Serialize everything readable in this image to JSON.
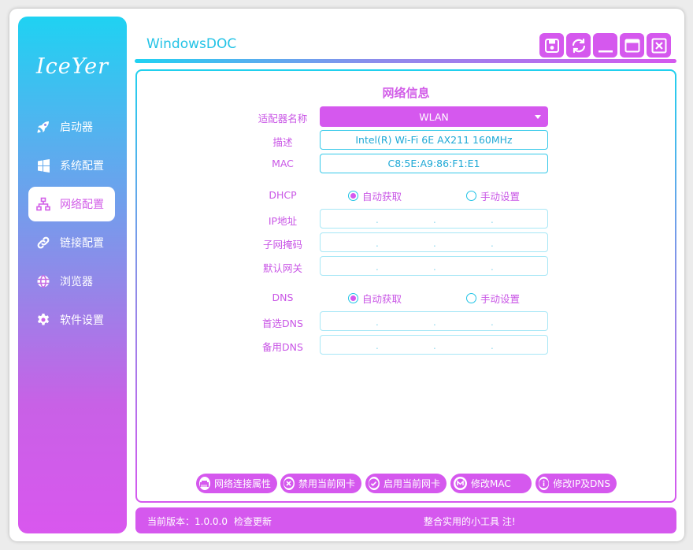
{
  "sidebar": {
    "logo": "IceYer",
    "items": [
      {
        "label": "启动器",
        "icon": "rocket-icon"
      },
      {
        "label": "系统配置",
        "icon": "windows-icon"
      },
      {
        "label": "网络配置",
        "icon": "network-icon"
      },
      {
        "label": "链接配置",
        "icon": "link-icon"
      },
      {
        "label": "浏览器",
        "icon": "globe-icon"
      },
      {
        "label": "软件设置",
        "icon": "gear-icon"
      }
    ],
    "active_index": 2
  },
  "header": {
    "title": "WindowsDOC",
    "buttons": [
      "save-icon",
      "refresh-icon",
      "minimize-icon",
      "maximize-icon",
      "close-icon"
    ]
  },
  "panel": {
    "title": "网络信息",
    "adapter_label": "适配器名称",
    "adapter_value": "WLAN",
    "desc_label": "描述",
    "desc_value": "Intel(R) Wi-Fi 6E AX211 160MHz",
    "mac_label": "MAC",
    "mac_value": "C8:5E:A9:86:F1:E1",
    "dhcp_label": "DHCP",
    "dhcp_auto": "自动获取",
    "dhcp_manual": "手动设置",
    "ip_label": "IP地址",
    "mask_label": "子网掩码",
    "gateway_label": "默认网关",
    "dns_label": "DNS",
    "dns_auto": "自动获取",
    "dns_manual": "手动设置",
    "dns1_label": "首选DNS",
    "dns2_label": "备用DNS"
  },
  "actions": [
    {
      "label": "网络连接属性",
      "icon": "ethernet-icon"
    },
    {
      "label": "禁用当前网卡",
      "icon": "disable-icon"
    },
    {
      "label": "启用当前网卡",
      "icon": "check-icon"
    },
    {
      "label": "修改MAC",
      "icon": "mac-icon"
    },
    {
      "label": "修改IP及DNS",
      "icon": "info-icon"
    }
  ],
  "status": {
    "version": "当前版本：1.0.0.0",
    "check_update": "检查更新",
    "slogan": "整合实用的小工具 注!"
  },
  "colors": {
    "accent": "#d558ee",
    "cyan": "#1fd2f2"
  }
}
